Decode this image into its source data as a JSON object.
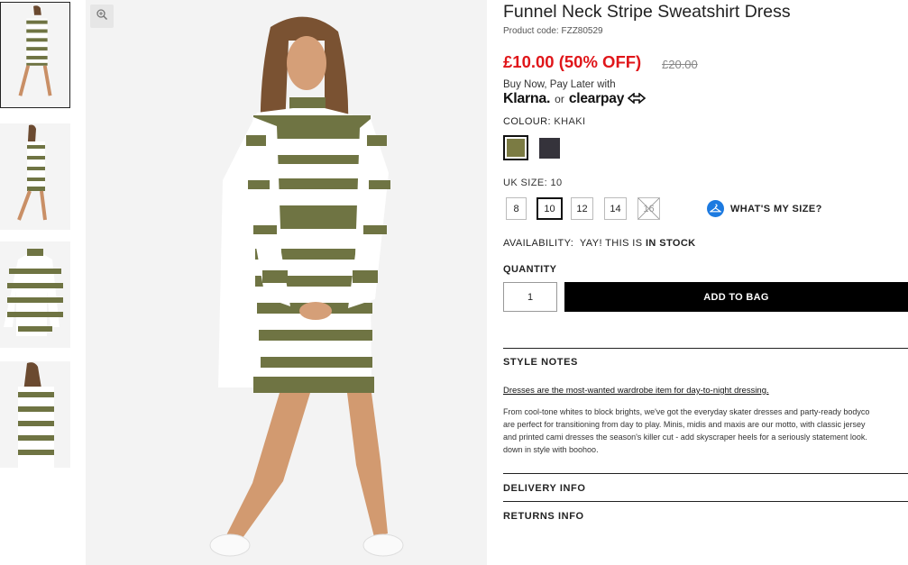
{
  "product": {
    "title": "Funnel Neck Stripe Sweatshirt Dress",
    "code": "Product code: FZZ80529",
    "price_now": "£10.00 (50% OFF)",
    "price_was": "£20.00"
  },
  "payment": {
    "intro": "Buy Now, Pay Later with",
    "klarna": "Klarna.",
    "or": "or",
    "clearpay": "clearpay"
  },
  "colour": {
    "label": "COLOUR:",
    "value": "KHAKI",
    "swatches": [
      {
        "name": "Khaki",
        "color": "#7b7b43",
        "selected": true
      },
      {
        "name": "Dark",
        "color": "#35333b",
        "selected": false
      }
    ]
  },
  "size": {
    "label": "UK SIZE:",
    "value": "10",
    "options": [
      "8",
      "10",
      "12",
      "14",
      "16"
    ],
    "whats_my_size": "WHAT'S MY SIZE?"
  },
  "availability": {
    "label": "AVAILABILITY:",
    "text": "YAY! THIS IS",
    "status": "IN STOCK"
  },
  "quantity": {
    "label": "QUANTITY",
    "value": "1"
  },
  "add_to_bag": "ADD TO BAG",
  "style_notes": {
    "heading": "STYLE NOTES",
    "lead": "Dresses are the most-wanted wardrobe item for day-to-night dressing.",
    "lines": [
      "From cool-tone whites to block brights, we've got the everyday skater dresses and party-ready bodyco",
      "are perfect for transitioning from day to play. Minis, midis and maxis are our motto, with classic jersey",
      "and printed cami dresses the season's killer cut - add skyscraper heels for a seriously statement look.",
      "down in style with boohoo."
    ]
  },
  "delivery_info": "DELIVERY INFO",
  "returns_info": "RETURNS INFO",
  "colors": {
    "sale_red": "#e0161a",
    "stripe_khaki": "#6f7443",
    "button_black": "#000000",
    "info_blue": "#1c7ae0"
  }
}
